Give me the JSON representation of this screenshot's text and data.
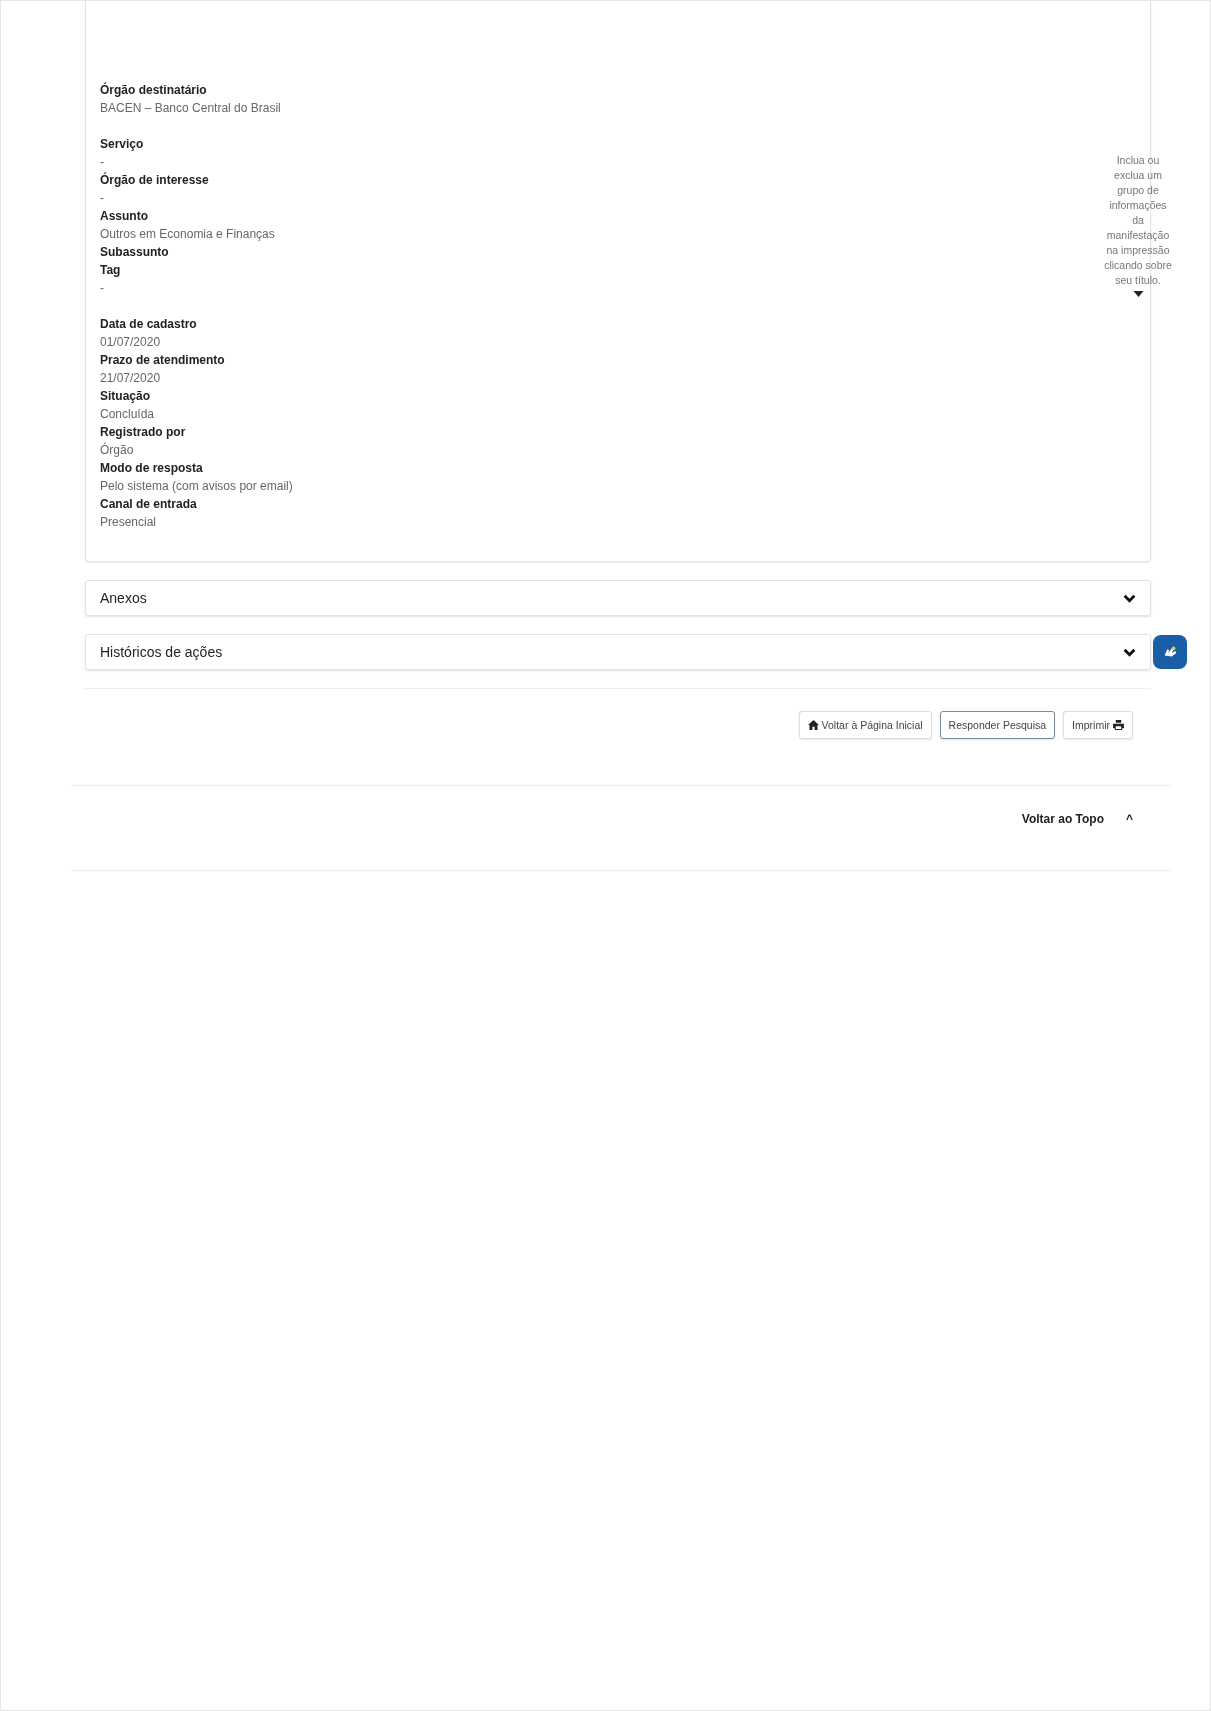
{
  "details": {
    "sections": [
      [
        {
          "label": "Órgão destinatário",
          "value": "BACEN – Banco Central do Brasil"
        }
      ],
      [
        {
          "label": "Serviço",
          "value": "-"
        },
        {
          "label": "Órgão de interesse",
          "value": "-"
        },
        {
          "label": "Assunto",
          "value": "Outros em Economia e Finanças"
        },
        {
          "label": "Subassunto"
        },
        {
          "label": "Tag",
          "value": "-"
        }
      ],
      [
        {
          "label": "Data de cadastro",
          "value": "01/07/2020"
        },
        {
          "label": "Prazo de atendimento",
          "value": "21/07/2020"
        },
        {
          "label": "Situação",
          "value": "Concluída"
        },
        {
          "label": "Registrado por",
          "value": "Órgão"
        },
        {
          "label": "Modo de resposta",
          "value": "Pelo sistema (com avisos por email)"
        },
        {
          "label": "Canal de entrada",
          "value": "Presencial"
        }
      ]
    ],
    "hint": "Inclua ou exclua um grupo de informações da manifestação na impressão clicando sobre seu título."
  },
  "panels": [
    {
      "title": "Anexos",
      "expanded": false
    },
    {
      "title": "Históricos de ações",
      "expanded": false
    }
  ],
  "buttons": [
    {
      "kind": "home",
      "label": "Voltar à Página Inicial"
    },
    {
      "kind": "plain",
      "label": "Responder Pesquisa"
    },
    {
      "kind": "print",
      "label": "Imprimir"
    }
  ],
  "back_to_top": {
    "label": "Voltar ao Topo",
    "arrow": "^"
  }
}
